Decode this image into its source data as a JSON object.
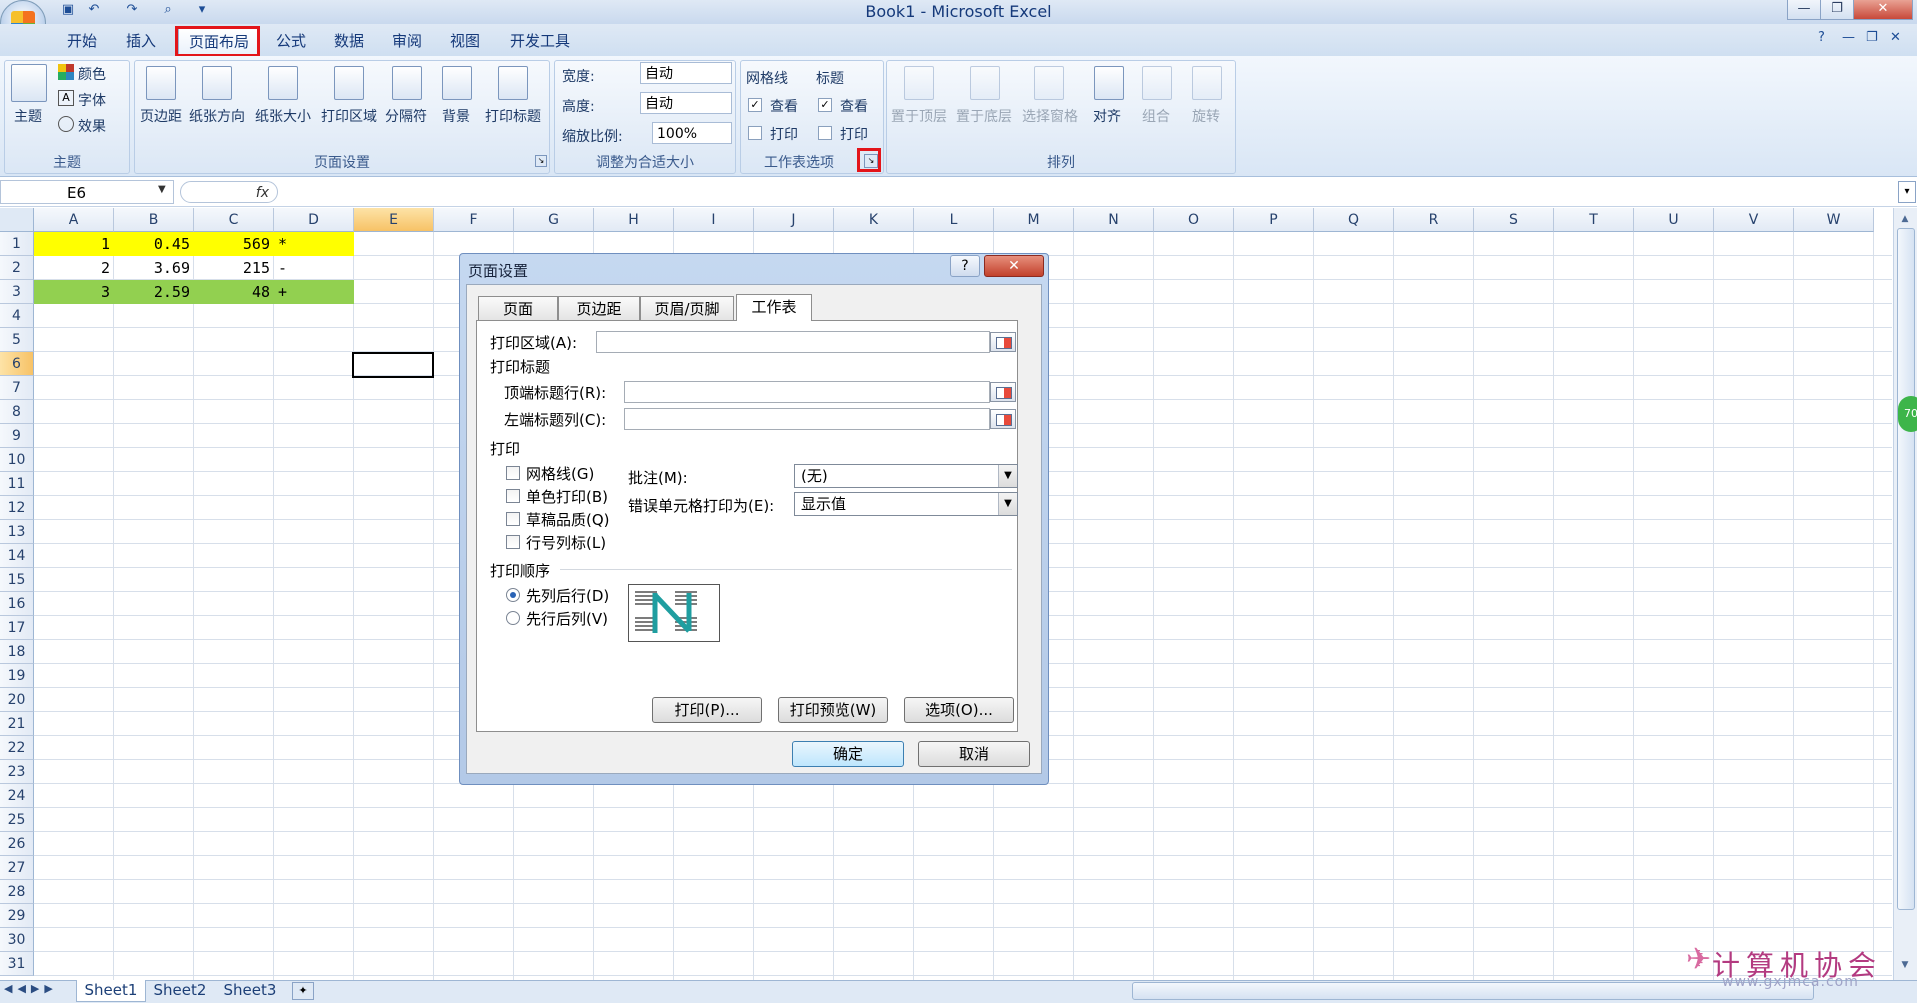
{
  "window": {
    "title": "Book1 - Microsoft Excel",
    "controls": [
      "—",
      "❐",
      "✕"
    ],
    "ribbon_controls": [
      "?",
      "—",
      "❐",
      "✕"
    ]
  },
  "ribbon": {
    "tabs": [
      "开始",
      "插入",
      "页面布局",
      "公式",
      "数据",
      "审阅",
      "视图",
      "开发工具"
    ],
    "active_tab": "页面布局",
    "groups": {
      "theme": {
        "label": "主题",
        "buttons": [
          "主题"
        ],
        "small_buttons": [
          "颜色",
          "字体",
          "效果"
        ]
      },
      "page_setup": {
        "label": "页面设置",
        "buttons": [
          "页边距",
          "纸张方向",
          "纸张大小",
          "打印区域",
          "分隔符",
          "背景",
          "打印标题"
        ]
      },
      "scale": {
        "label": "调整为合适大小",
        "width_label": "宽度:",
        "width_value": "自动",
        "height_label": "高度:",
        "height_value": "自动",
        "scale_label": "缩放比例:",
        "scale_value": "100%"
      },
      "sheet_options": {
        "label": "工作表选项",
        "gridlines": "网格线",
        "headings": "标题",
        "view": "查看",
        "print": "打印"
      },
      "arrange": {
        "label": "排列",
        "buttons": [
          "置于顶层",
          "置于底层",
          "选择窗格",
          "对齐",
          "组合",
          "旋转"
        ]
      }
    }
  },
  "formula_bar": {
    "name_box": "E6",
    "fx_label": "fx",
    "formula": ""
  },
  "grid": {
    "columns": [
      "A",
      "B",
      "C",
      "D",
      "E",
      "F",
      "G",
      "H",
      "I",
      "J",
      "K",
      "L",
      "M",
      "N",
      "O",
      "P",
      "Q",
      "R",
      "S",
      "T",
      "U",
      "V",
      "W"
    ],
    "rows": [
      "1",
      "2",
      "3",
      "4",
      "5",
      "6",
      "7",
      "8",
      "9",
      "10",
      "11",
      "12",
      "13",
      "14",
      "15",
      "16",
      "17",
      "18",
      "19",
      "20",
      "21",
      "22",
      "23",
      "24",
      "25",
      "26",
      "27",
      "28",
      "29",
      "30",
      "31"
    ],
    "selected_cell": "E6",
    "cells": [
      {
        "a": "1",
        "b": "0.45",
        "c": "569",
        "d": "*",
        "fill": "#ffff00"
      },
      {
        "a": "2",
        "b": "3.69",
        "c": "215",
        "d": "-",
        "fill": ""
      },
      {
        "a": "3",
        "b": "2.59",
        "c": "48",
        "d": "+",
        "fill": "#92d050"
      }
    ]
  },
  "sheet_tabs": [
    "Sheet1",
    "Sheet2",
    "Sheet3"
  ],
  "side_badge": "70",
  "watermark": {
    "main": "计算机协会",
    "url": "www.gxjmca.com"
  },
  "dialog": {
    "title": "页面设置",
    "help": "?",
    "close": "✕",
    "tabs": [
      "页面",
      "页边距",
      "页眉/页脚",
      "工作表"
    ],
    "active_tab": "工作表",
    "print_area_label": "打印区域(A):",
    "print_titles_label": "打印标题",
    "top_rows_label": "顶端标题行(R):",
    "left_cols_label": "左端标题列(C):",
    "print_section_label": "打印",
    "checkboxes": [
      "网格线(G)",
      "单色打印(B)",
      "草稿品质(Q)",
      "行号列标(L)"
    ],
    "comments_label": "批注(M):",
    "comments_value": "(无)",
    "errors_label": "错误单元格打印为(E):",
    "errors_value": "显示值",
    "order_label": "打印顺序",
    "order_options": [
      "先列后行(D)",
      "先行后列(V)"
    ],
    "order_selected": "先列后行(D)",
    "buttons": {
      "print": "打印(P)...",
      "preview": "打印预览(W)",
      "options": "选项(O)...",
      "ok": "确定",
      "cancel": "取消"
    }
  },
  "colors": {
    "highlight_red": "#e3151a",
    "yellow_fill": "#ffff00",
    "green_fill": "#92d050",
    "selected_header": "#f7c266"
  }
}
